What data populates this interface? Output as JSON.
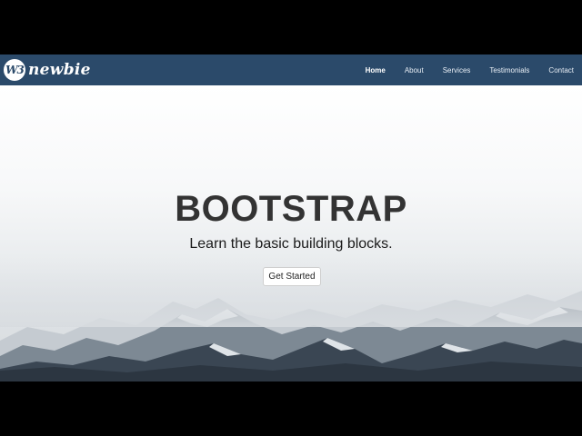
{
  "navbar": {
    "logo_badge": "W3",
    "logo_text": "newbie",
    "links": [
      {
        "label": "Home"
      },
      {
        "label": "About"
      },
      {
        "label": "Services"
      },
      {
        "label": "Testimonials"
      },
      {
        "label": "Contact"
      }
    ],
    "active_link": "Home",
    "background_color": "#2b4a6a"
  },
  "hero": {
    "title": "BOOTSTRAP",
    "subtitle": "Learn the basic building blocks.",
    "cta_label": "Get Started",
    "background": "snowy-mountains-image"
  }
}
